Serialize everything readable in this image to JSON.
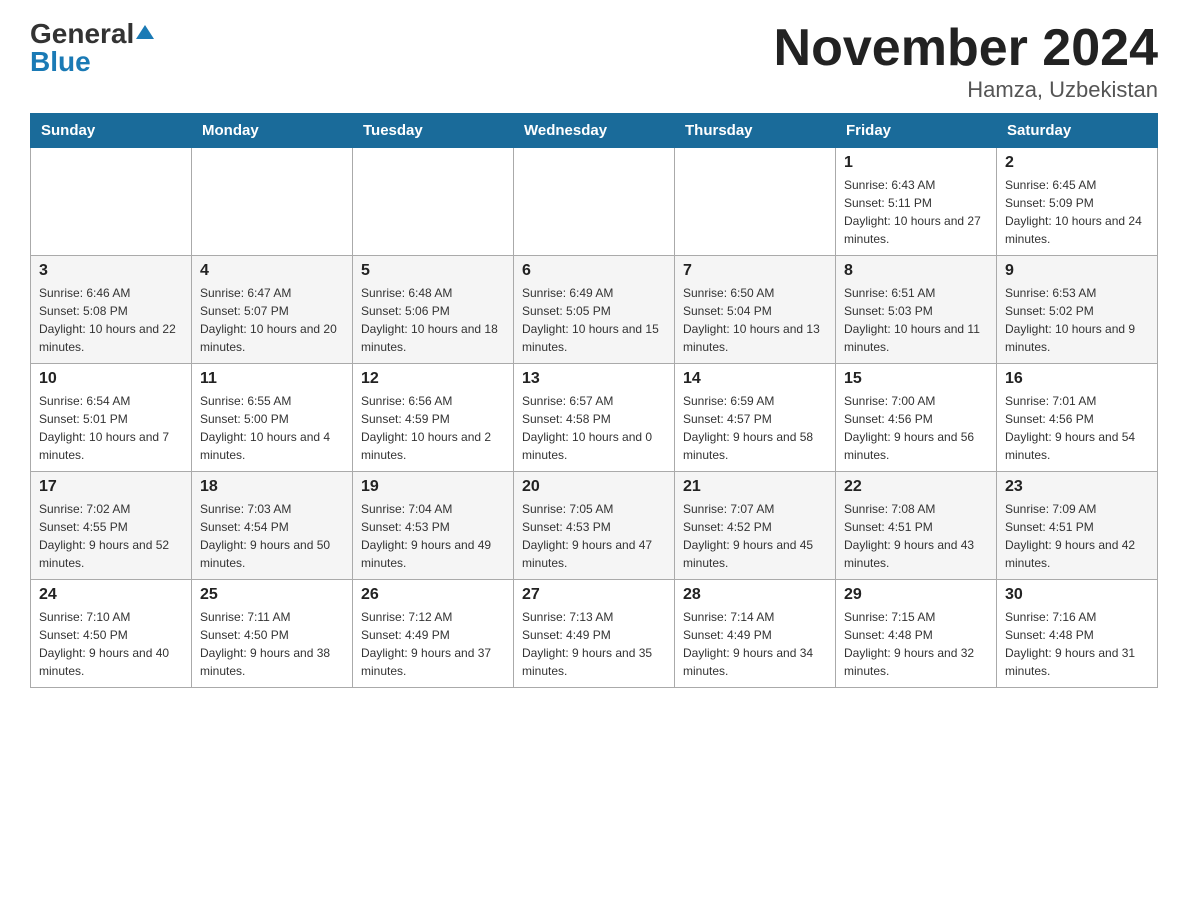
{
  "logo": {
    "general": "General",
    "blue": "Blue"
  },
  "title": "November 2024",
  "location": "Hamza, Uzbekistan",
  "days_of_week": [
    "Sunday",
    "Monday",
    "Tuesday",
    "Wednesday",
    "Thursday",
    "Friday",
    "Saturday"
  ],
  "weeks": [
    [
      {
        "day": "",
        "info": ""
      },
      {
        "day": "",
        "info": ""
      },
      {
        "day": "",
        "info": ""
      },
      {
        "day": "",
        "info": ""
      },
      {
        "day": "",
        "info": ""
      },
      {
        "day": "1",
        "info": "Sunrise: 6:43 AM\nSunset: 5:11 PM\nDaylight: 10 hours and 27 minutes."
      },
      {
        "day": "2",
        "info": "Sunrise: 6:45 AM\nSunset: 5:09 PM\nDaylight: 10 hours and 24 minutes."
      }
    ],
    [
      {
        "day": "3",
        "info": "Sunrise: 6:46 AM\nSunset: 5:08 PM\nDaylight: 10 hours and 22 minutes."
      },
      {
        "day": "4",
        "info": "Sunrise: 6:47 AM\nSunset: 5:07 PM\nDaylight: 10 hours and 20 minutes."
      },
      {
        "day": "5",
        "info": "Sunrise: 6:48 AM\nSunset: 5:06 PM\nDaylight: 10 hours and 18 minutes."
      },
      {
        "day": "6",
        "info": "Sunrise: 6:49 AM\nSunset: 5:05 PM\nDaylight: 10 hours and 15 minutes."
      },
      {
        "day": "7",
        "info": "Sunrise: 6:50 AM\nSunset: 5:04 PM\nDaylight: 10 hours and 13 minutes."
      },
      {
        "day": "8",
        "info": "Sunrise: 6:51 AM\nSunset: 5:03 PM\nDaylight: 10 hours and 11 minutes."
      },
      {
        "day": "9",
        "info": "Sunrise: 6:53 AM\nSunset: 5:02 PM\nDaylight: 10 hours and 9 minutes."
      }
    ],
    [
      {
        "day": "10",
        "info": "Sunrise: 6:54 AM\nSunset: 5:01 PM\nDaylight: 10 hours and 7 minutes."
      },
      {
        "day": "11",
        "info": "Sunrise: 6:55 AM\nSunset: 5:00 PM\nDaylight: 10 hours and 4 minutes."
      },
      {
        "day": "12",
        "info": "Sunrise: 6:56 AM\nSunset: 4:59 PM\nDaylight: 10 hours and 2 minutes."
      },
      {
        "day": "13",
        "info": "Sunrise: 6:57 AM\nSunset: 4:58 PM\nDaylight: 10 hours and 0 minutes."
      },
      {
        "day": "14",
        "info": "Sunrise: 6:59 AM\nSunset: 4:57 PM\nDaylight: 9 hours and 58 minutes."
      },
      {
        "day": "15",
        "info": "Sunrise: 7:00 AM\nSunset: 4:56 PM\nDaylight: 9 hours and 56 minutes."
      },
      {
        "day": "16",
        "info": "Sunrise: 7:01 AM\nSunset: 4:56 PM\nDaylight: 9 hours and 54 minutes."
      }
    ],
    [
      {
        "day": "17",
        "info": "Sunrise: 7:02 AM\nSunset: 4:55 PM\nDaylight: 9 hours and 52 minutes."
      },
      {
        "day": "18",
        "info": "Sunrise: 7:03 AM\nSunset: 4:54 PM\nDaylight: 9 hours and 50 minutes."
      },
      {
        "day": "19",
        "info": "Sunrise: 7:04 AM\nSunset: 4:53 PM\nDaylight: 9 hours and 49 minutes."
      },
      {
        "day": "20",
        "info": "Sunrise: 7:05 AM\nSunset: 4:53 PM\nDaylight: 9 hours and 47 minutes."
      },
      {
        "day": "21",
        "info": "Sunrise: 7:07 AM\nSunset: 4:52 PM\nDaylight: 9 hours and 45 minutes."
      },
      {
        "day": "22",
        "info": "Sunrise: 7:08 AM\nSunset: 4:51 PM\nDaylight: 9 hours and 43 minutes."
      },
      {
        "day": "23",
        "info": "Sunrise: 7:09 AM\nSunset: 4:51 PM\nDaylight: 9 hours and 42 minutes."
      }
    ],
    [
      {
        "day": "24",
        "info": "Sunrise: 7:10 AM\nSunset: 4:50 PM\nDaylight: 9 hours and 40 minutes."
      },
      {
        "day": "25",
        "info": "Sunrise: 7:11 AM\nSunset: 4:50 PM\nDaylight: 9 hours and 38 minutes."
      },
      {
        "day": "26",
        "info": "Sunrise: 7:12 AM\nSunset: 4:49 PM\nDaylight: 9 hours and 37 minutes."
      },
      {
        "day": "27",
        "info": "Sunrise: 7:13 AM\nSunset: 4:49 PM\nDaylight: 9 hours and 35 minutes."
      },
      {
        "day": "28",
        "info": "Sunrise: 7:14 AM\nSunset: 4:49 PM\nDaylight: 9 hours and 34 minutes."
      },
      {
        "day": "29",
        "info": "Sunrise: 7:15 AM\nSunset: 4:48 PM\nDaylight: 9 hours and 32 minutes."
      },
      {
        "day": "30",
        "info": "Sunrise: 7:16 AM\nSunset: 4:48 PM\nDaylight: 9 hours and 31 minutes."
      }
    ]
  ]
}
